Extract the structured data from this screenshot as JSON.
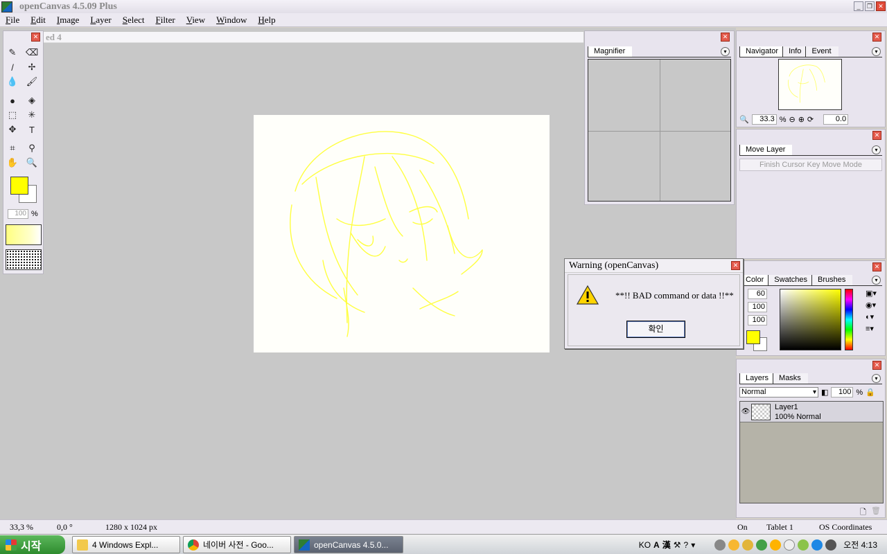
{
  "window": {
    "title": "openCanvas 4.5.09 Plus"
  },
  "menu": [
    "File",
    "Edit",
    "Image",
    "Layer",
    "Select",
    "Filter",
    "View",
    "Window",
    "Help"
  ],
  "document": {
    "tab_fragment": "ed 4"
  },
  "toolbox": {
    "opacity_value": "100",
    "opacity_unit": "%",
    "colors": {
      "foreground": "#ffff00",
      "background": "#ffffff"
    }
  },
  "magnifier": {
    "tab": "Magnifier"
  },
  "navigator": {
    "tabs": [
      "Navigator",
      "Info",
      "Event"
    ],
    "zoom": "33.3",
    "zoom_unit": "%",
    "rotation": "0.0"
  },
  "move_layer": {
    "tab": "Move Layer",
    "button": "Finish Cursor Key Move Mode"
  },
  "color_panel": {
    "tabs": [
      "Color",
      "Swatches",
      "Brushes"
    ],
    "values": [
      "60",
      "100",
      "100"
    ]
  },
  "layers_panel": {
    "tabs": [
      "Layers",
      "Masks"
    ],
    "blend_mode": "Normal",
    "opacity": "100",
    "opacity_unit": "%",
    "layers": [
      {
        "name": "Layer1",
        "detail": "100% Normal"
      }
    ]
  },
  "dialog": {
    "title": "Warning (openCanvas)",
    "message": "**!! BAD command or data !!**",
    "ok_label": "확인"
  },
  "status": {
    "zoom": "33,3 %",
    "angle": "0,0 °",
    "size": "1280 x 1024 px",
    "pressure": "On",
    "tablet": "Tablet 1",
    "coords": "OS Coordinates"
  },
  "taskbar": {
    "start_label": "시작",
    "buttons": [
      {
        "label": "4 Windows Expl..."
      },
      {
        "label": "네이버 사전 - Goo..."
      },
      {
        "label": "openCanvas 4.5.0..."
      }
    ],
    "ime": "KO",
    "ime_mode_a": "A",
    "ime_mode_han": "漢",
    "clock": "오전 4:13"
  }
}
